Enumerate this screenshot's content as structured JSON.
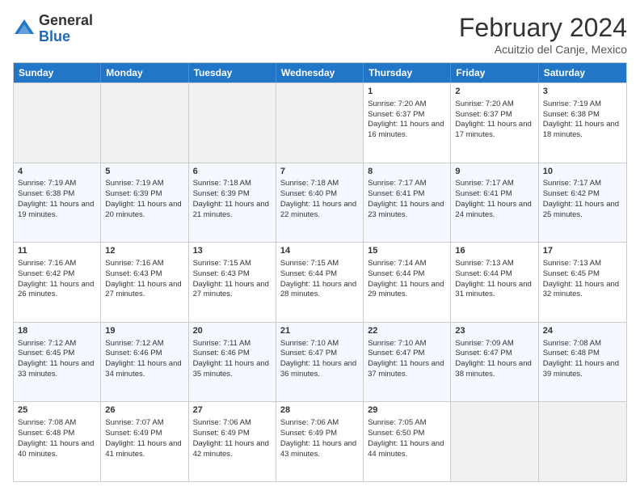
{
  "header": {
    "logo_general": "General",
    "logo_blue": "Blue",
    "month_title": "February 2024",
    "subtitle": "Acuitzio del Canje, Mexico"
  },
  "days_of_week": [
    "Sunday",
    "Monday",
    "Tuesday",
    "Wednesday",
    "Thursday",
    "Friday",
    "Saturday"
  ],
  "weeks": [
    [
      {
        "day": "",
        "info": ""
      },
      {
        "day": "",
        "info": ""
      },
      {
        "day": "",
        "info": ""
      },
      {
        "day": "",
        "info": ""
      },
      {
        "day": "1",
        "info": "Sunrise: 7:20 AM\nSunset: 6:37 PM\nDaylight: 11 hours and 16 minutes."
      },
      {
        "day": "2",
        "info": "Sunrise: 7:20 AM\nSunset: 6:37 PM\nDaylight: 11 hours and 17 minutes."
      },
      {
        "day": "3",
        "info": "Sunrise: 7:19 AM\nSunset: 6:38 PM\nDaylight: 11 hours and 18 minutes."
      }
    ],
    [
      {
        "day": "4",
        "info": "Sunrise: 7:19 AM\nSunset: 6:38 PM\nDaylight: 11 hours and 19 minutes."
      },
      {
        "day": "5",
        "info": "Sunrise: 7:19 AM\nSunset: 6:39 PM\nDaylight: 11 hours and 20 minutes."
      },
      {
        "day": "6",
        "info": "Sunrise: 7:18 AM\nSunset: 6:39 PM\nDaylight: 11 hours and 21 minutes."
      },
      {
        "day": "7",
        "info": "Sunrise: 7:18 AM\nSunset: 6:40 PM\nDaylight: 11 hours and 22 minutes."
      },
      {
        "day": "8",
        "info": "Sunrise: 7:17 AM\nSunset: 6:41 PM\nDaylight: 11 hours and 23 minutes."
      },
      {
        "day": "9",
        "info": "Sunrise: 7:17 AM\nSunset: 6:41 PM\nDaylight: 11 hours and 24 minutes."
      },
      {
        "day": "10",
        "info": "Sunrise: 7:17 AM\nSunset: 6:42 PM\nDaylight: 11 hours and 25 minutes."
      }
    ],
    [
      {
        "day": "11",
        "info": "Sunrise: 7:16 AM\nSunset: 6:42 PM\nDaylight: 11 hours and 26 minutes."
      },
      {
        "day": "12",
        "info": "Sunrise: 7:16 AM\nSunset: 6:43 PM\nDaylight: 11 hours and 27 minutes."
      },
      {
        "day": "13",
        "info": "Sunrise: 7:15 AM\nSunset: 6:43 PM\nDaylight: 11 hours and 27 minutes."
      },
      {
        "day": "14",
        "info": "Sunrise: 7:15 AM\nSunset: 6:44 PM\nDaylight: 11 hours and 28 minutes."
      },
      {
        "day": "15",
        "info": "Sunrise: 7:14 AM\nSunset: 6:44 PM\nDaylight: 11 hours and 29 minutes."
      },
      {
        "day": "16",
        "info": "Sunrise: 7:13 AM\nSunset: 6:44 PM\nDaylight: 11 hours and 31 minutes."
      },
      {
        "day": "17",
        "info": "Sunrise: 7:13 AM\nSunset: 6:45 PM\nDaylight: 11 hours and 32 minutes."
      }
    ],
    [
      {
        "day": "18",
        "info": "Sunrise: 7:12 AM\nSunset: 6:45 PM\nDaylight: 11 hours and 33 minutes."
      },
      {
        "day": "19",
        "info": "Sunrise: 7:12 AM\nSunset: 6:46 PM\nDaylight: 11 hours and 34 minutes."
      },
      {
        "day": "20",
        "info": "Sunrise: 7:11 AM\nSunset: 6:46 PM\nDaylight: 11 hours and 35 minutes."
      },
      {
        "day": "21",
        "info": "Sunrise: 7:10 AM\nSunset: 6:47 PM\nDaylight: 11 hours and 36 minutes."
      },
      {
        "day": "22",
        "info": "Sunrise: 7:10 AM\nSunset: 6:47 PM\nDaylight: 11 hours and 37 minutes."
      },
      {
        "day": "23",
        "info": "Sunrise: 7:09 AM\nSunset: 6:47 PM\nDaylight: 11 hours and 38 minutes."
      },
      {
        "day": "24",
        "info": "Sunrise: 7:08 AM\nSunset: 6:48 PM\nDaylight: 11 hours and 39 minutes."
      }
    ],
    [
      {
        "day": "25",
        "info": "Sunrise: 7:08 AM\nSunset: 6:48 PM\nDaylight: 11 hours and 40 minutes."
      },
      {
        "day": "26",
        "info": "Sunrise: 7:07 AM\nSunset: 6:49 PM\nDaylight: 11 hours and 41 minutes."
      },
      {
        "day": "27",
        "info": "Sunrise: 7:06 AM\nSunset: 6:49 PM\nDaylight: 11 hours and 42 minutes."
      },
      {
        "day": "28",
        "info": "Sunrise: 7:06 AM\nSunset: 6:49 PM\nDaylight: 11 hours and 43 minutes."
      },
      {
        "day": "29",
        "info": "Sunrise: 7:05 AM\nSunset: 6:50 PM\nDaylight: 11 hours and 44 minutes."
      },
      {
        "day": "",
        "info": ""
      },
      {
        "day": "",
        "info": ""
      }
    ]
  ]
}
